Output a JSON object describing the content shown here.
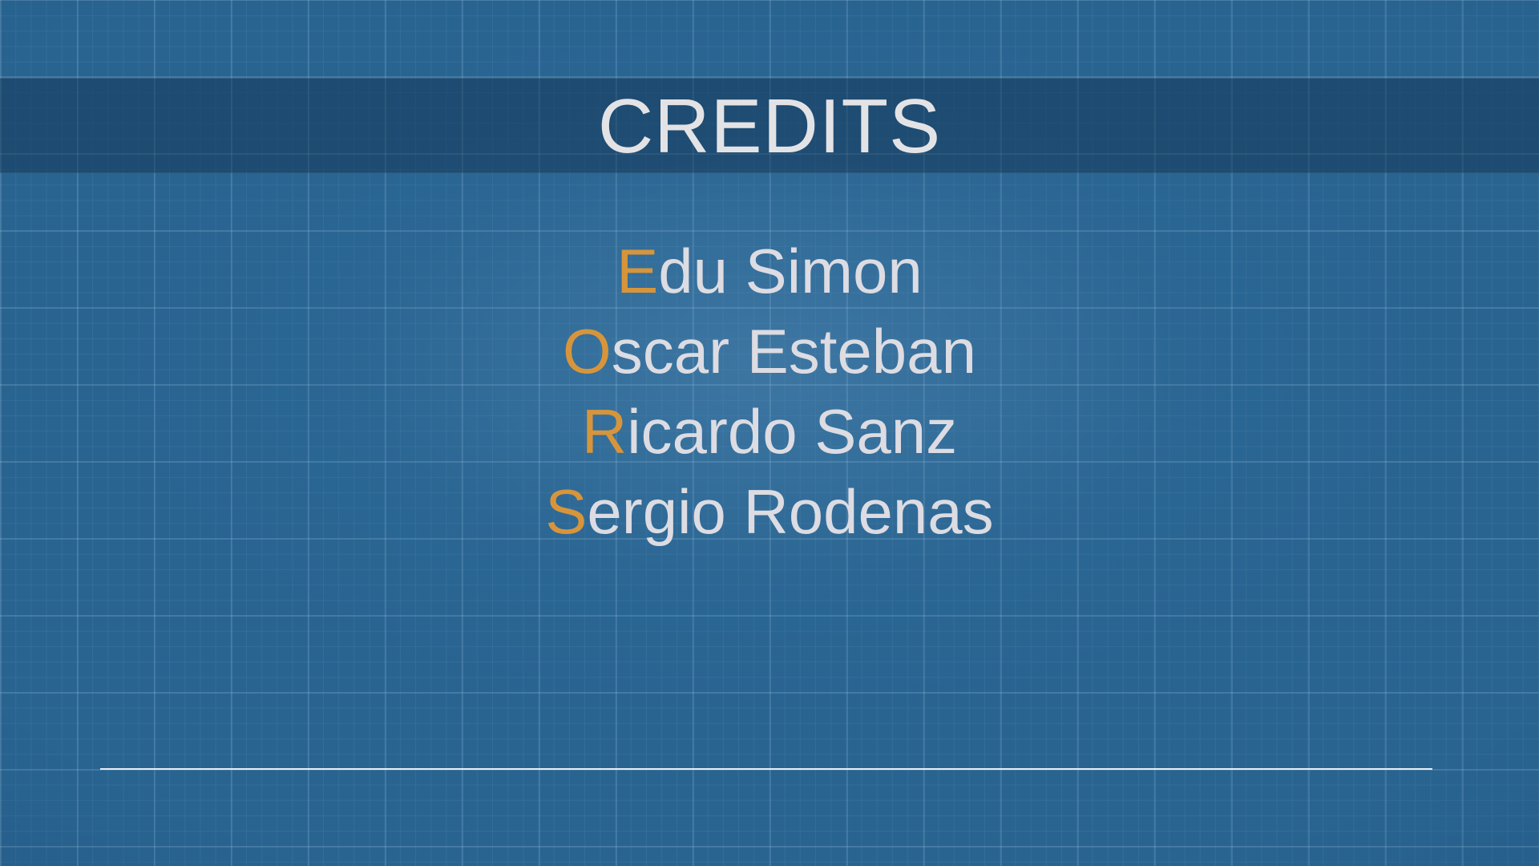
{
  "slide": {
    "title": "CREDITS",
    "accent_color": "#d7953b",
    "text_color": "#dcdce2",
    "background_color": "#296491"
  },
  "credits": [
    {
      "initial": "E",
      "rest": "du Simon"
    },
    {
      "initial": "O",
      "rest": "scar Esteban"
    },
    {
      "initial": "R",
      "rest": "icardo Sanz"
    },
    {
      "initial": "S",
      "rest": "ergio Rodenas"
    }
  ]
}
